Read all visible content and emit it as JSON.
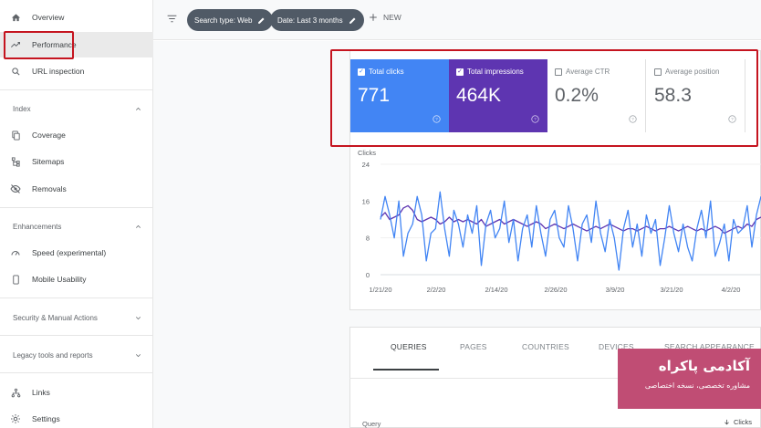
{
  "sidebar": {
    "items": [
      {
        "label": "Overview",
        "icon": "home-icon"
      },
      {
        "label": "Performance",
        "icon": "trending-up-icon"
      },
      {
        "label": "URL inspection",
        "icon": "search-icon"
      }
    ],
    "index_section": {
      "title": "Index",
      "items": [
        {
          "label": "Coverage",
          "icon": "file-copy-icon"
        },
        {
          "label": "Sitemaps",
          "icon": "sitemap-icon"
        },
        {
          "label": "Removals",
          "icon": "eye-off-icon"
        }
      ]
    },
    "enhancements_section": {
      "title": "Enhancements",
      "items": [
        {
          "label": "Speed (experimental)",
          "icon": "speedometer-icon"
        },
        {
          "label": "Mobile Usability",
          "icon": "smartphone-icon"
        }
      ]
    },
    "security_section": {
      "title": "Security & Manual Actions"
    },
    "legacy_section": {
      "title": "Legacy tools and reports"
    },
    "bottom_items": [
      {
        "label": "Links",
        "icon": "links-icon"
      },
      {
        "label": "Settings",
        "icon": "gear-icon"
      }
    ]
  },
  "toolbar": {
    "chip_search_type": "Search type: Web",
    "chip_date": "Date: Last 3 months",
    "new_label": "NEW"
  },
  "metrics": [
    {
      "label": "Total clicks",
      "value": "771",
      "checked": true,
      "color": "#4285f4"
    },
    {
      "label": "Total impressions",
      "value": "464K",
      "checked": true,
      "color": "#5e35b1"
    },
    {
      "label": "Average CTR",
      "value": "0.2%",
      "checked": false
    },
    {
      "label": "Average position",
      "value": "58.3",
      "checked": false
    }
  ],
  "chart_data": {
    "type": "line",
    "ylabel": "Clicks",
    "ylim": [
      0,
      24
    ],
    "yticks": [
      "24",
      "16",
      "8",
      "0"
    ],
    "xticks": [
      "1/21/20",
      "2/2/20",
      "2/14/20",
      "2/26/20",
      "3/9/20",
      "3/21/20",
      "4/2/20"
    ],
    "series": [
      {
        "name": "Clicks",
        "color": "#4285f4",
        "values": [
          12,
          17,
          13,
          8,
          16,
          4,
          9,
          11,
          17,
          13,
          3,
          9,
          10,
          18,
          10,
          4,
          14,
          11,
          6,
          13,
          9,
          15,
          2,
          11,
          14,
          8,
          10,
          16,
          7,
          12,
          3,
          10,
          13,
          6,
          15,
          9,
          4,
          12,
          14,
          8,
          6,
          15,
          10,
          3,
          11,
          13,
          7,
          16,
          9,
          5,
          12,
          8,
          1,
          10,
          14,
          6,
          11,
          4,
          13,
          9,
          12,
          2,
          8,
          15,
          9,
          5,
          11,
          6,
          3,
          10,
          14,
          8,
          16,
          4,
          7,
          11,
          3,
          12,
          9,
          10,
          15,
          6,
          13,
          17
        ]
      },
      {
        "name": "Impressions",
        "color": "#5e35b1",
        "values": [
          12.5,
          13.5,
          12,
          12.5,
          13,
          14.5,
          15,
          14,
          12,
          11.5,
          12,
          12.5,
          12,
          11,
          11.5,
          12.5,
          11.5,
          12,
          11.5,
          12,
          11.5,
          11,
          12,
          10.5,
          11,
          11.5,
          12,
          11,
          11.5,
          12,
          11.5,
          11,
          10.5,
          11,
          11.5,
          11,
          10,
          10.5,
          11,
          10.5,
          10,
          10.5,
          11,
          10.5,
          10,
          9.5,
          10,
          10.5,
          10,
          10.5,
          11,
          10.5,
          10,
          9.5,
          10,
          10,
          9.5,
          10,
          10.5,
          10,
          9.5,
          10,
          10,
          10.5,
          10,
          9.5,
          10,
          10.5,
          10,
          9.5,
          10,
          9.5,
          10,
          10.5,
          10,
          9,
          9.5,
          10,
          10.5,
          10,
          11,
          10.5,
          12,
          12.5
        ]
      }
    ]
  },
  "tabs": [
    "QUERIES",
    "PAGES",
    "COUNTRIES",
    "DEVICES",
    "SEARCH APPEARANCE"
  ],
  "table": {
    "col_query": "Query",
    "col_clicks": "Clicks"
  },
  "watermark": {
    "title": "آکادمی پاکراه",
    "subtitle": "مشاوره تخصصی، نسخه اختصاصی"
  }
}
